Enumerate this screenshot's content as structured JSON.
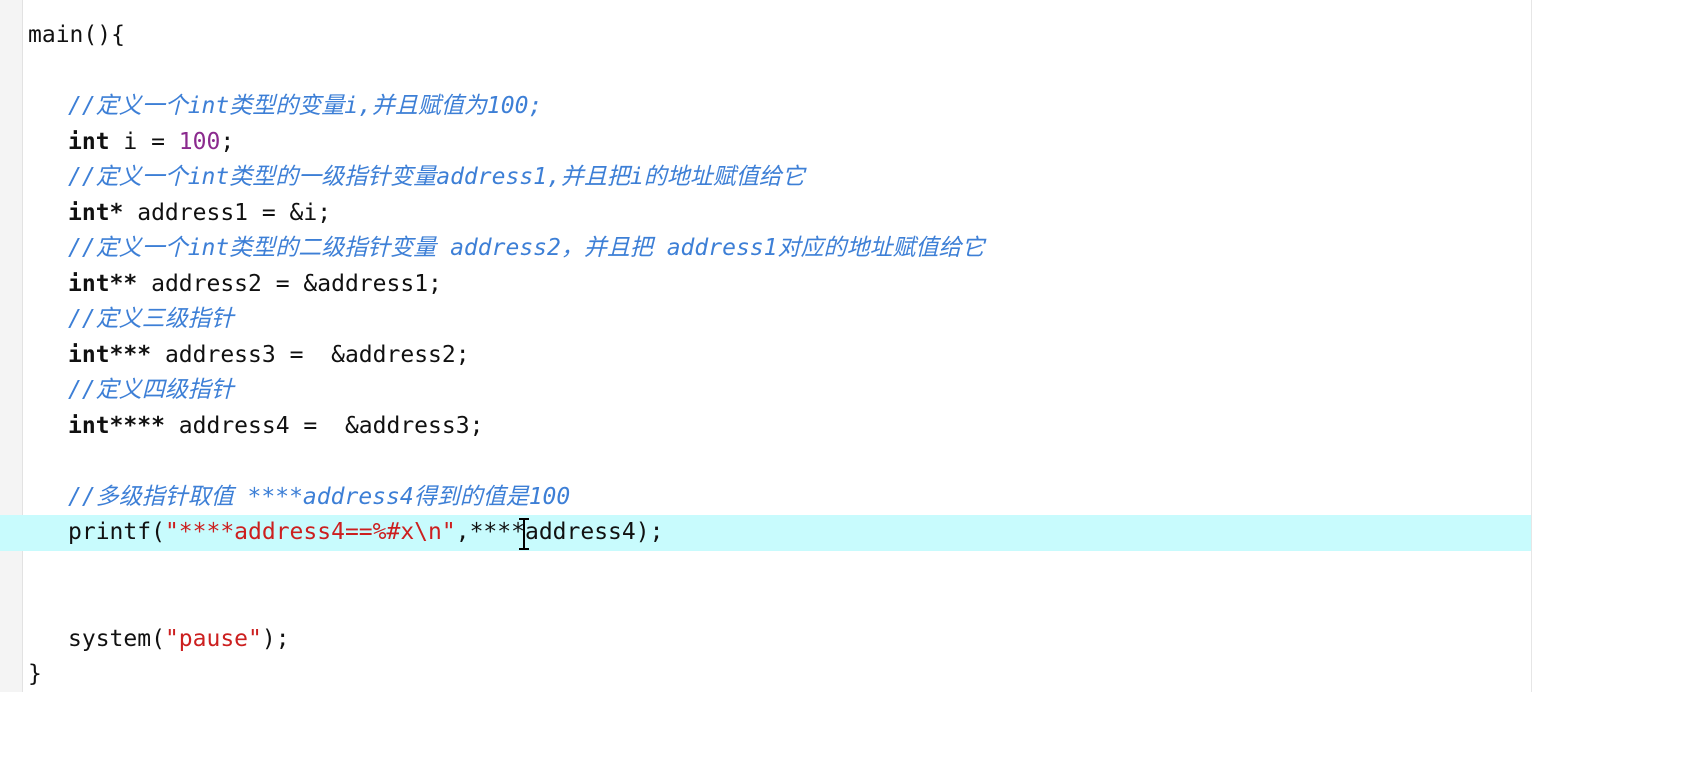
{
  "editor": {
    "lines": {
      "l1": {
        "fn": "main(){"
      },
      "l2": {},
      "l3": {
        "comment": "//定义一个int类型的变量i,并且赋值为100;"
      },
      "l4": {
        "kw": "int",
        "mid": " i = ",
        "num": "100",
        "end": ";"
      },
      "l5": {
        "comment": "//定义一个int类型的一级指针变量address1,并且把i的地址赋值给它"
      },
      "l6": {
        "kw": "int*",
        "rest": " address1 = &i;"
      },
      "l7": {
        "comment": "//定义一个int类型的二级指针变量 address2，并且把 address1对应的地址赋值给它"
      },
      "l8": {
        "kw": "int**",
        "rest": " address2 = &address1;"
      },
      "l9": {
        "comment": "//定义三级指针"
      },
      "l10": {
        "kw": "int***",
        "rest": " address3 =  &address2;"
      },
      "l11": {
        "comment": "//定义四级指针"
      },
      "l12": {
        "kw": "int****",
        "rest": " address4 =  &address3;"
      },
      "l13": {},
      "l14": {
        "comment": "//多级指针取值 ****address4得到的值是100"
      },
      "l15": {
        "fn": "printf(",
        "str": "\"****address4==%#x\\n\"",
        "rest": ",****address4);"
      },
      "l16": {},
      "l17": {},
      "l18": {
        "fn": "system(",
        "str": "\"pause\"",
        "rest": ");"
      },
      "l19": {
        "fn": "}"
      }
    }
  },
  "colors": {
    "keyword": "#111111",
    "number": "#8b2a8e",
    "string": "#cc1f1f",
    "comment": "#3d7fd6",
    "current_line": "#c8fbfd"
  },
  "icons": {
    "cursor": "text-cursor-ibeam-icon"
  }
}
